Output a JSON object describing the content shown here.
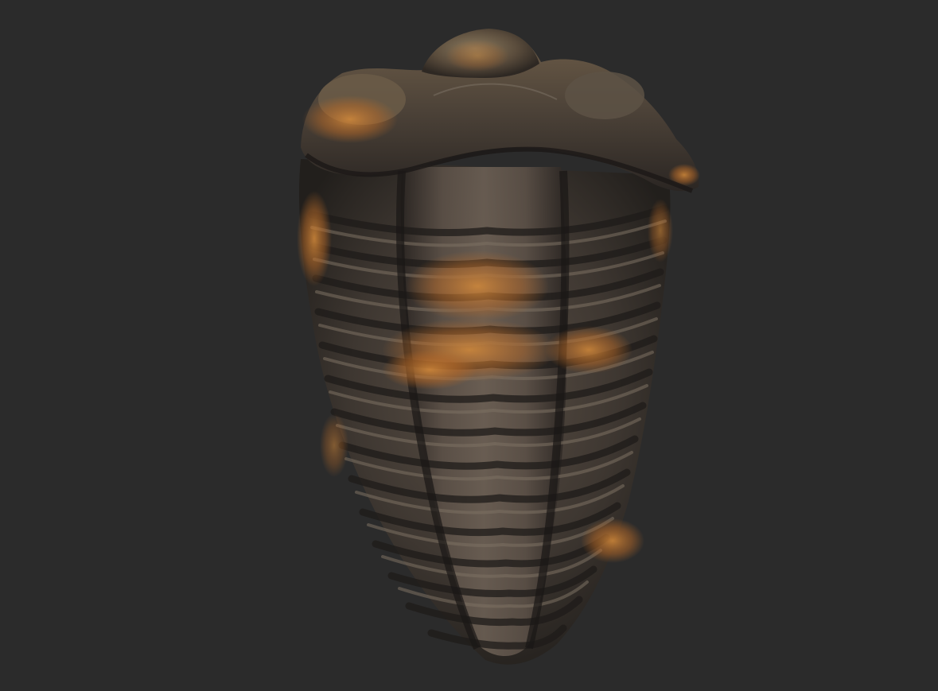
{
  "scene": {
    "background_color": "#2b2b2b",
    "subject": "trilobite-fossil-icon",
    "palette": {
      "shell_dark": "#2e2a26",
      "shell_mid": "#4a423b",
      "shell_light": "#6a5f55",
      "rust": "#b86a28",
      "rust_light": "#d48a3a",
      "highlight": "#8a7f72"
    }
  }
}
